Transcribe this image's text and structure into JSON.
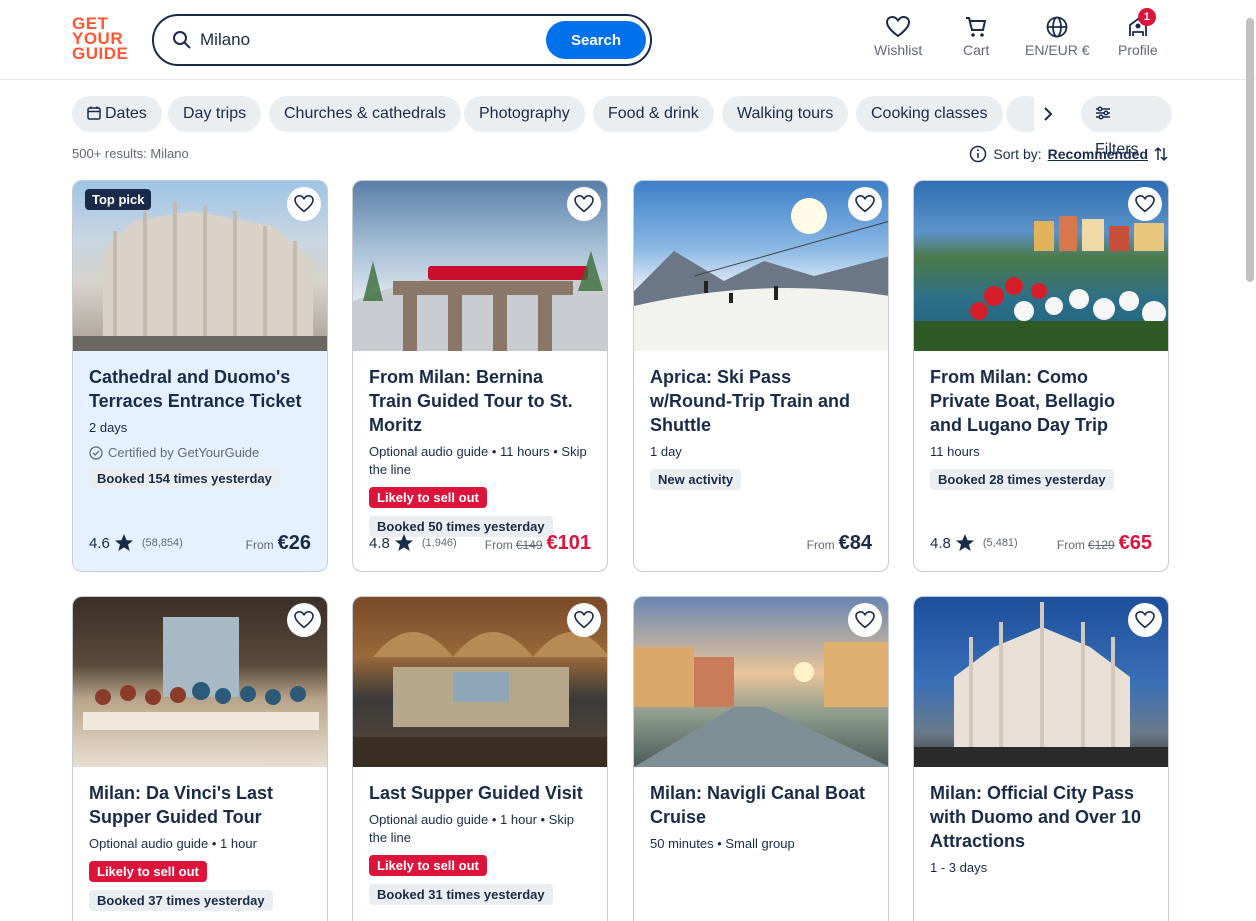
{
  "logo": {
    "line1": "GET",
    "line2": "YOUR",
    "line3": "GUIDE"
  },
  "search": {
    "value": "Milano",
    "button": "Search"
  },
  "header_nav": {
    "wishlist": "Wishlist",
    "cart": "Cart",
    "language": "EN/EUR €",
    "profile": "Profile",
    "profile_badge": "1"
  },
  "chips": [
    "Dates",
    "Day trips",
    "Churches & cathedrals",
    "Photography",
    "Food & drink",
    "Walking tours",
    "Cooking classes"
  ],
  "filters_label": "Filters",
  "results_text": "500+ results: Milano",
  "sort": {
    "label": "Sort by:",
    "value": "Recommended"
  },
  "cards": [
    {
      "title": "Cathedral and Duomo's Terraces Entrance Ticket",
      "meta": "2 days",
      "certified": "Certified by GetYourGuide",
      "booked": "Booked 154 times yesterday",
      "rating": "4.6",
      "reviews": "(58,854)",
      "from": "From",
      "price": "€26",
      "badge": "Top pick"
    },
    {
      "title": "From Milan: Bernina Train Guided Tour to St. Moritz",
      "meta": "Optional audio guide • 11 hours • Skip the line",
      "likely": "Likely to sell out",
      "booked": "Booked 50 times yesterday",
      "rating": "4.8",
      "reviews": "(1,946)",
      "from": "From",
      "old_price": "€149",
      "price": "€101"
    },
    {
      "title": "Aprica: Ski Pass w/Round-Trip Train and Shuttle",
      "meta": "1 day",
      "new": "New activity",
      "from": "From",
      "price": "€84"
    },
    {
      "title": "From Milan: Como Private Boat, Bellagio and Lugano Day Trip",
      "meta": "11 hours",
      "booked": "Booked 28 times yesterday",
      "rating": "4.8",
      "reviews": "(5,481)",
      "from": "From",
      "old_price": "€129",
      "price": "€65"
    },
    {
      "title": "Milan: Da Vinci's Last Supper Guided Tour",
      "meta": "Optional audio guide • 1 hour",
      "likely": "Likely to sell out",
      "booked": "Booked 37 times yesterday"
    },
    {
      "title": "Last Supper Guided Visit",
      "meta": "Optional audio guide • 1 hour • Skip the line",
      "likely": "Likely to sell out",
      "booked": "Booked 31 times yesterday"
    },
    {
      "title": "Milan: Navigli Canal Boat Cruise",
      "meta": "50 minutes • Small group"
    },
    {
      "title": "Milan: Official City Pass with Duomo and Over 10 Attractions",
      "meta": "1 - 3 days"
    }
  ],
  "colors": {
    "brand": "#ff5533",
    "primary": "#0071eb",
    "navy": "#1a2b49",
    "sale": "#dc143c",
    "highlight": "#e5f1fe"
  }
}
